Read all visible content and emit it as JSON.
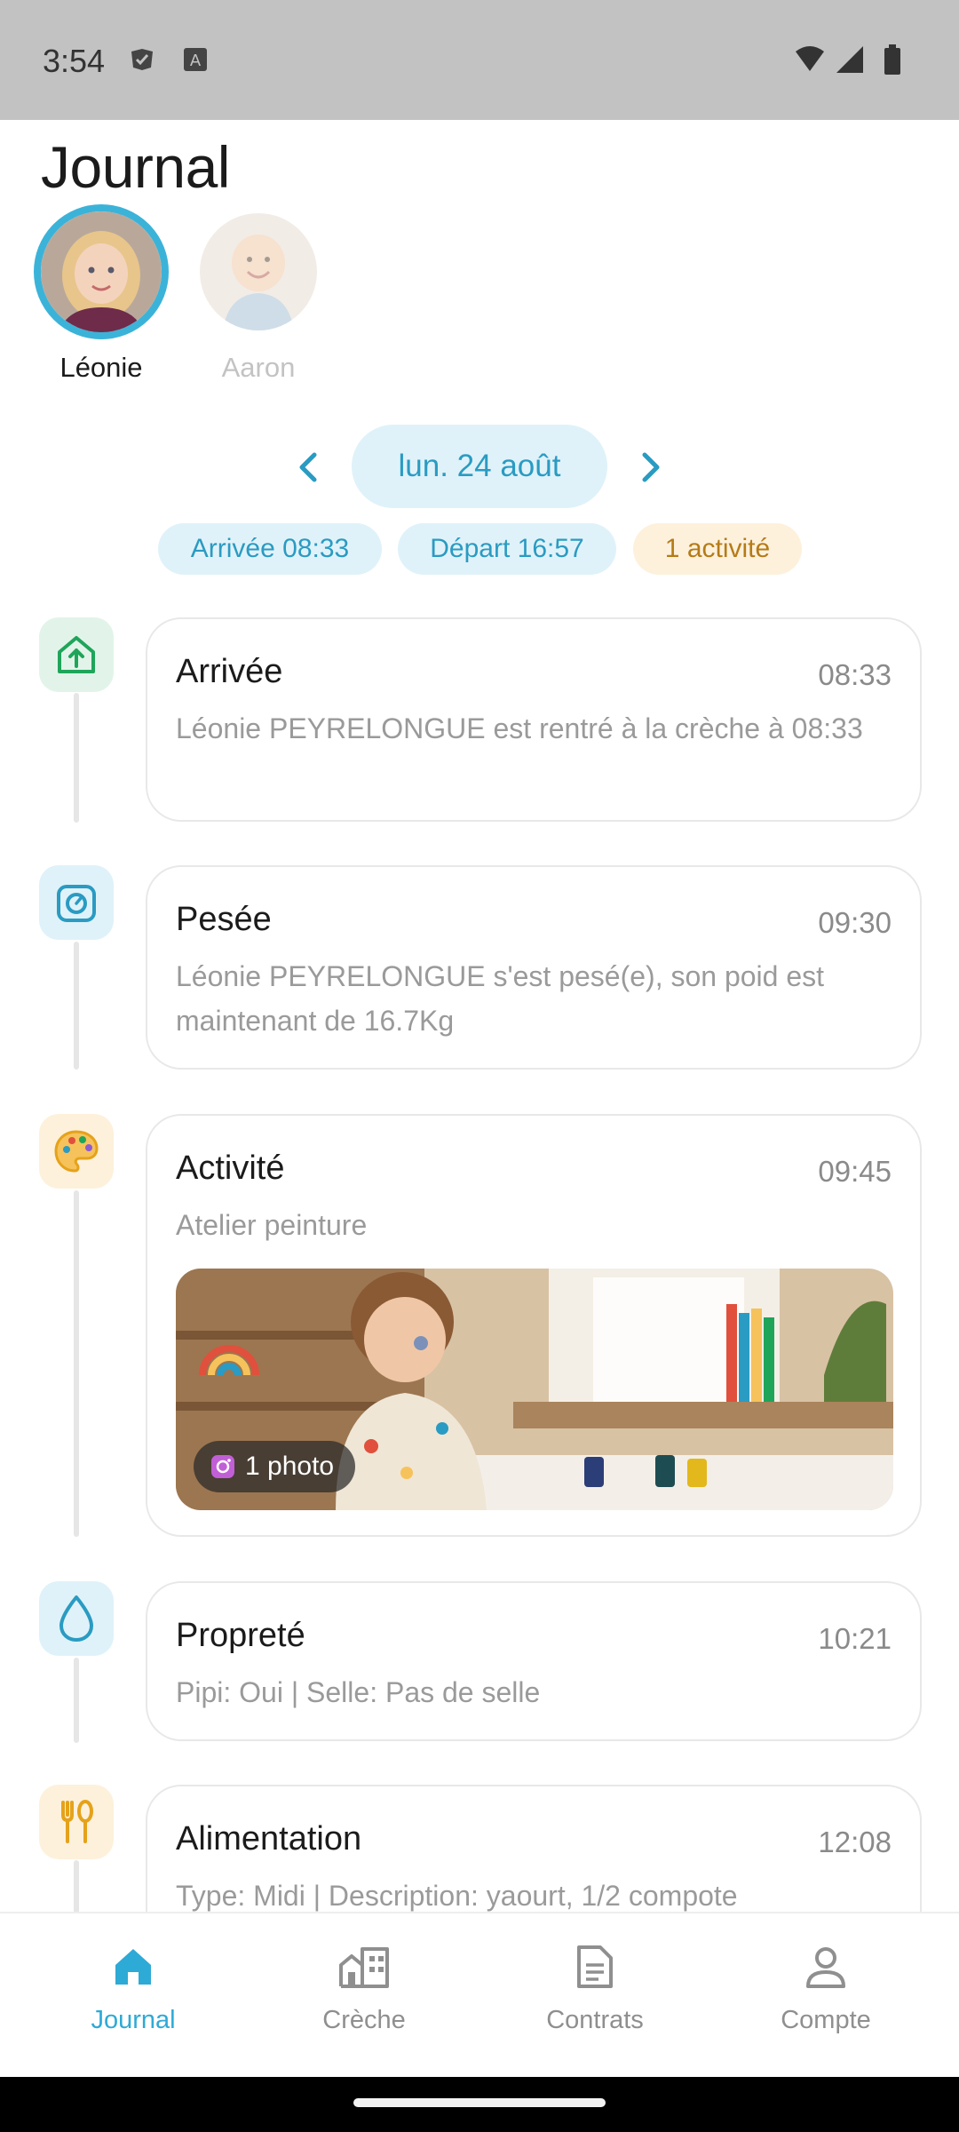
{
  "status_bar": {
    "time": "3:54",
    "left_icons": [
      "task-check-icon",
      "font-a-icon"
    ],
    "right_icons": [
      "wifi-icon",
      "signal-icon",
      "battery-icon"
    ]
  },
  "header": {
    "title": "Journal"
  },
  "children": [
    {
      "name": "Léonie",
      "selected": true
    },
    {
      "name": "Aaron",
      "selected": false
    }
  ],
  "date_nav": {
    "date": "lun. 24 août",
    "prev_icon": "chevron-left-icon",
    "next_icon": "chevron-right-icon"
  },
  "summary": {
    "arrival": "Arrivée 08:33",
    "departure": "Départ 16:57",
    "activities": "1 activité"
  },
  "timeline": [
    {
      "title": "Arrivée",
      "time": "08:33",
      "description": "Léonie PEYRELONGUE est rentré à la crèche à 08:33",
      "icon": "house-arrow-up-icon",
      "color": "#1fa55a"
    },
    {
      "title": "Pesée",
      "time": "09:30",
      "description": "Léonie PEYRELONGUE s'est pesé(e), son poid est maintenant de 16.7Kg",
      "icon": "scale-icon",
      "color": "#2a9bc2"
    },
    {
      "title": "Activité",
      "time": "09:45",
      "description": "Atelier peinture",
      "photo_badge": "1 photo",
      "icon": "palette-icon",
      "color": "#e5a21a"
    },
    {
      "title": "Propreté",
      "time": "10:21",
      "description": "Pipi: Oui | Selle: Pas de selle",
      "icon": "water-drop-icon",
      "color": "#2a9bc2"
    },
    {
      "title": "Alimentation",
      "time": "12:08",
      "description": "Type: Midi | Description: yaourt, 1/2 compote",
      "icon": "utensils-icon",
      "color": "#e5a21a"
    }
  ],
  "bottom_nav": [
    {
      "label": "Journal",
      "icon": "home-icon",
      "active": true
    },
    {
      "label": "Crèche",
      "icon": "building-icon",
      "active": false
    },
    {
      "label": "Contrats",
      "icon": "document-icon",
      "active": false
    },
    {
      "label": "Compte",
      "icon": "person-icon",
      "active": false
    }
  ],
  "colors": {
    "accent": "#2eaad6",
    "chip_blue_bg": "#e0f2f9",
    "chip_orange_bg": "#fdf1dc"
  }
}
